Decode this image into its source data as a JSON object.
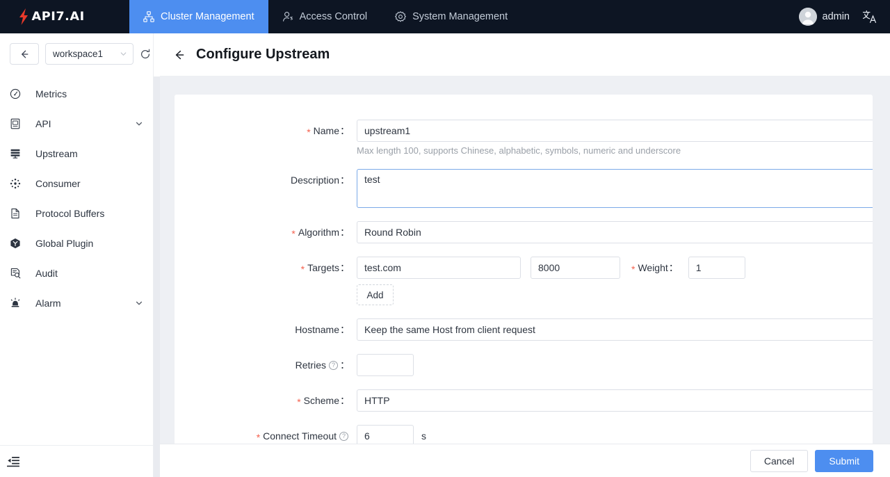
{
  "brand": {
    "name": "API7.AI",
    "accent": "#e8392a",
    "nav_bg": "#0d1523",
    "active_tab": "#4d8ef0"
  },
  "topnav": {
    "tabs": [
      {
        "label": "Cluster Management",
        "icon": "cluster-icon",
        "active": true
      },
      {
        "label": "Access Control",
        "icon": "access-control-icon",
        "active": false
      },
      {
        "label": "System Management",
        "icon": "gear-icon",
        "active": false
      }
    ],
    "user": "admin",
    "language_icon": "translate-icon"
  },
  "sidebar": {
    "back_icon": "arrow-left-icon",
    "workspace": "workspace1",
    "refresh_icon": "refresh-icon",
    "collapse_icon": "menu-fold-icon",
    "items": [
      {
        "label": "Metrics",
        "icon": "dashboard-icon",
        "expandable": false
      },
      {
        "label": "API",
        "icon": "api-icon",
        "expandable": true
      },
      {
        "label": "Upstream",
        "icon": "server-icon",
        "expandable": false
      },
      {
        "label": "Consumer",
        "icon": "consumer-icon",
        "expandable": false
      },
      {
        "label": "Protocol Buffers",
        "icon": "file-icon",
        "expandable": false
      },
      {
        "label": "Global Plugin",
        "icon": "plugin-icon",
        "expandable": false
      },
      {
        "label": "Audit",
        "icon": "audit-icon",
        "expandable": false
      },
      {
        "label": "Alarm",
        "icon": "alarm-icon",
        "expandable": true
      }
    ]
  },
  "page": {
    "title": "Configure Upstream",
    "back_icon": "arrow-left-icon"
  },
  "form": {
    "name": {
      "label": "Name",
      "required": true,
      "value": "upstream1",
      "hint": "Max length 100, supports Chinese, alphabetic, symbols, numeric and underscore"
    },
    "description": {
      "label": "Description",
      "required": false,
      "value": "test"
    },
    "algorithm": {
      "label": "Algorithm",
      "required": true,
      "value": "Round Robin"
    },
    "targets": {
      "label": "Targets",
      "required": true,
      "host": "test.com",
      "port": "8000",
      "weight_label": "Weight",
      "weight_required": true,
      "weight": "1",
      "add_label": "Add"
    },
    "hostname": {
      "label": "Hostname",
      "required": false,
      "value": "Keep the same Host from client request"
    },
    "retries": {
      "label": "Retries",
      "required": false,
      "value": "",
      "help": "?"
    },
    "scheme": {
      "label": "Scheme",
      "required": true,
      "value": "HTTP"
    },
    "connect_timeout": {
      "label": "Connect Timeout",
      "required": true,
      "value": "6",
      "unit": "s",
      "help": "?"
    }
  },
  "footer": {
    "cancel": "Cancel",
    "submit": "Submit"
  }
}
